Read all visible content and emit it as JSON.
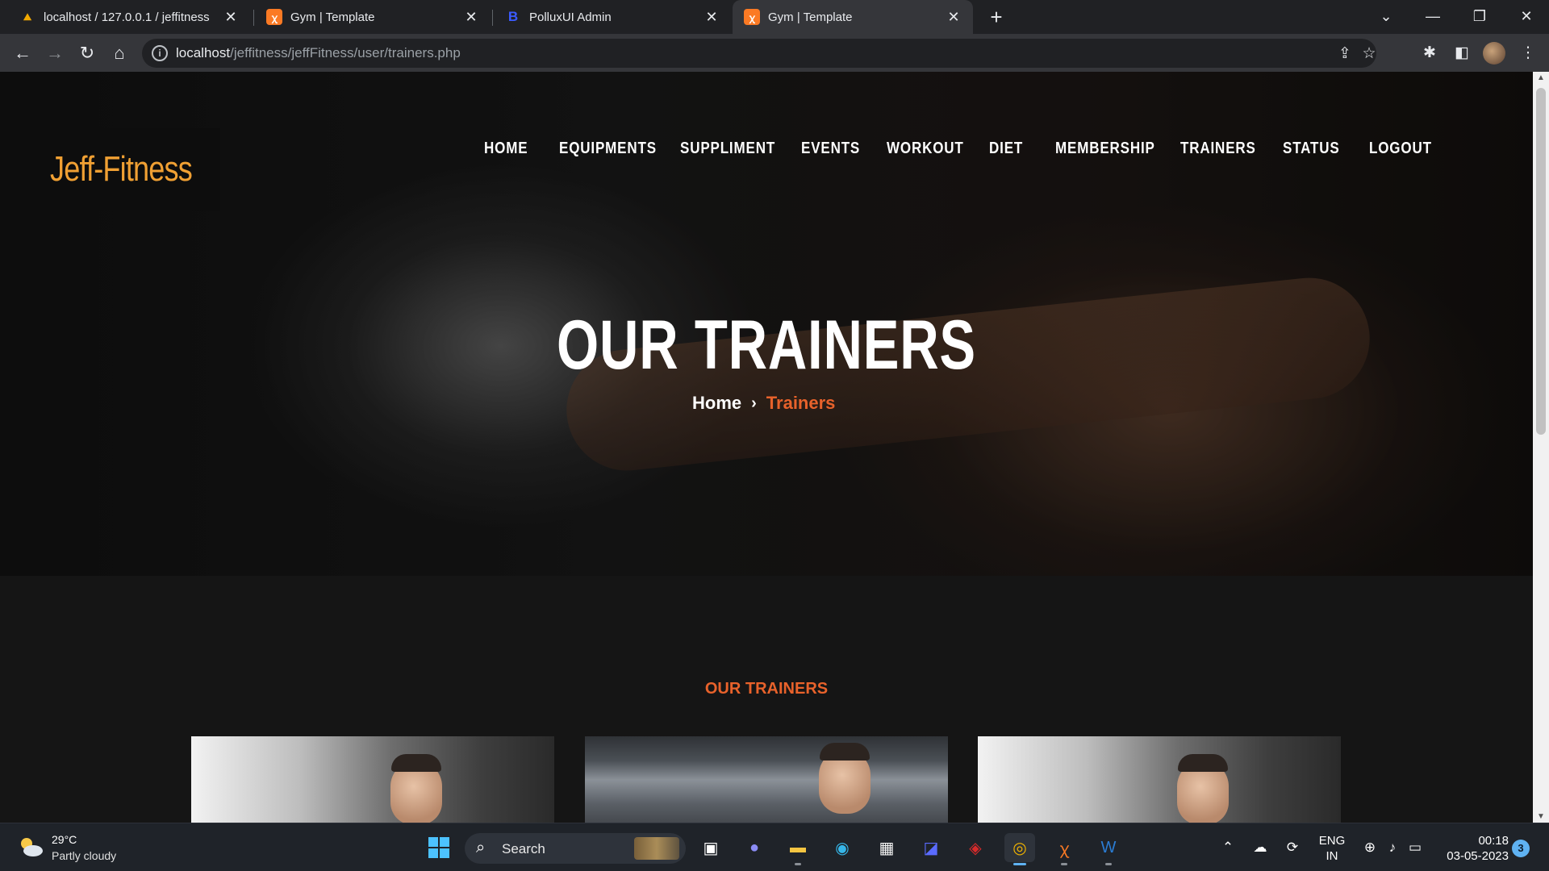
{
  "browser": {
    "tabs": [
      {
        "title": "localhost / 127.0.0.1 / jeffitness",
        "favicon": "phpmyadmin-icon",
        "active": false
      },
      {
        "title": "Gym | Template",
        "favicon": "xampp-icon",
        "active": false
      },
      {
        "title": "PolluxUI Admin",
        "favicon": "bootstrap-icon",
        "active": false
      },
      {
        "title": "Gym | Template",
        "favicon": "xampp-icon",
        "active": true
      }
    ],
    "url_host": "localhost",
    "url_path": "/jeffitness/jeffFitness/user/trainers.php"
  },
  "site": {
    "logo": "Jeff-Fitness",
    "nav": [
      "HOME",
      "EQUIPMENTS",
      "SUPPLIMENT",
      "EVENTS",
      "WORKOUT",
      "DIET",
      "MEMBERSHIP",
      "TRAINERS",
      "STATUS",
      "LOGOUT"
    ],
    "hero_title": "OUR TRAINERS",
    "breadcrumb_home": "Home",
    "breadcrumb_separator": "›",
    "breadcrumb_current": "Trainers",
    "section_title": "OUR TRAINERS",
    "accent_color": "#e8622b",
    "logo_color": "#f0a033"
  },
  "taskbar": {
    "weather_temp": "29°C",
    "weather_desc": "Partly cloudy",
    "search_label": "Search",
    "apps": [
      "task-view-icon",
      "teams-chat-icon",
      "file-explorer-icon",
      "edge-icon",
      "microsoft-store-icon",
      "mathpix-icon",
      "mcafee-icon",
      "chrome-icon",
      "xampp-icon",
      "word-icon"
    ],
    "lang_line1": "ENG",
    "lang_line2": "IN",
    "time": "00:18",
    "date": "03-05-2023",
    "notification_count": "3"
  }
}
